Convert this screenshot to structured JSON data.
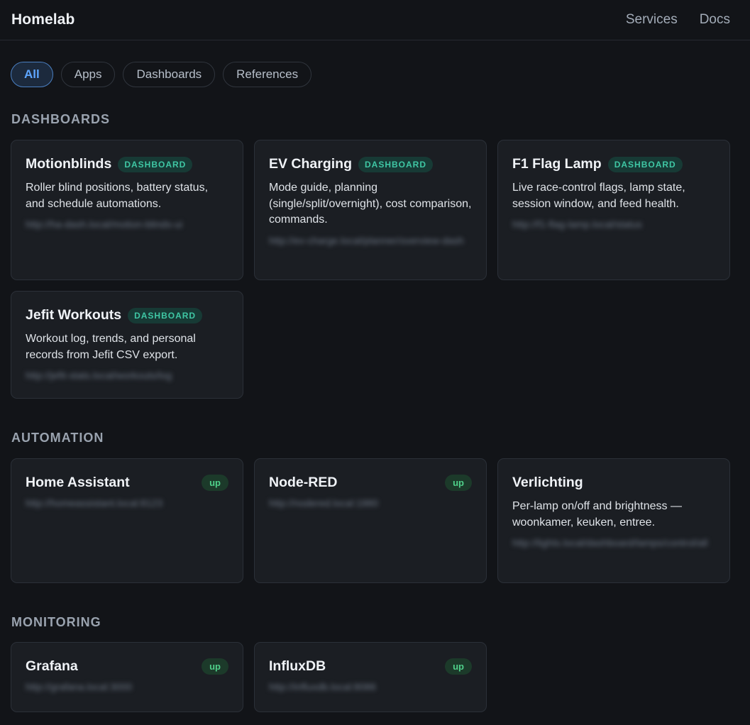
{
  "header": {
    "brand": "Homelab",
    "nav": [
      "Services",
      "Docs"
    ]
  },
  "filters": {
    "chips": [
      "All",
      "Apps",
      "Dashboards",
      "References"
    ],
    "active": "All"
  },
  "sections": {
    "dashboards": {
      "title": "DASHBOARDS",
      "cards": [
        {
          "title": "Motionblinds",
          "badge": "DASHBOARD",
          "desc": "Roller blind positions, battery status, and schedule automations.",
          "url": "http://ha-dash.local/motion-blinds-ui"
        },
        {
          "title": "EV Charging",
          "badge": "DASHBOARD",
          "desc": "Mode guide, planning (single/split/overnight), cost comparison, commands.",
          "url": "http://ev-charge.local/planner/overview-dash"
        },
        {
          "title": "F1 Flag Lamp",
          "badge": "DASHBOARD",
          "desc": "Live race-control flags, lamp state, session window, and feed health.",
          "url": "http://f1-flag-lamp.local/status"
        },
        {
          "title": "Jefit Workouts",
          "badge": "DASHBOARD",
          "desc": "Workout log, trends, and personal records from Jefit CSV export.",
          "url": "http://jefit-stats.local/workouts/log"
        }
      ]
    },
    "automation": {
      "title": "AUTOMATION",
      "cards": [
        {
          "title": "Home Assistant",
          "status": "up",
          "url": "http://homeassistant.local:8123"
        },
        {
          "title": "Node-RED",
          "status": "up",
          "url": "http://nodered.local:1880"
        },
        {
          "title": "Verlichting",
          "desc": "Per-lamp on/off and brightness — woonkamer, keuken, entree.",
          "url": "http://lights.local/dashboard/lamps/control/all"
        }
      ]
    },
    "monitoring": {
      "title": "MONITORING",
      "cards": [
        {
          "title": "Grafana",
          "status": "up",
          "url": "http://grafana.local:3000"
        },
        {
          "title": "InfluxDB",
          "status": "up",
          "url": "http://influxdb.local:8086"
        }
      ]
    }
  },
  "colors": {
    "background": "#121418",
    "card": "#1b1e23",
    "accent": "#5ea6ff",
    "badge_text": "#3fc7a4",
    "status_up": "#4fd08a"
  }
}
